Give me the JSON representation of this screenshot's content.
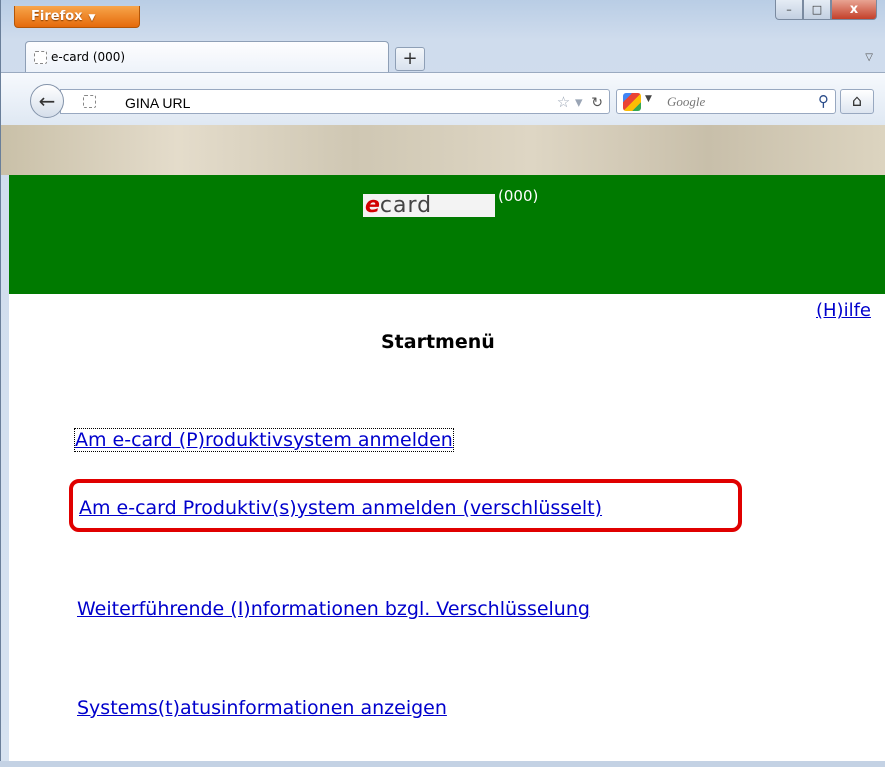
{
  "browser": {
    "app_button": "Firefox",
    "window_controls": {
      "minimize": "–",
      "maximize": "□",
      "close": "x"
    },
    "tab": {
      "title": "e-card (000)"
    },
    "new_tab_label": "+",
    "url": "GINA URL",
    "search": {
      "placeholder": "Google"
    }
  },
  "page": {
    "logo": {
      "e": "e",
      "card": "card"
    },
    "code": "(000)",
    "help_link": "(H)ilfe",
    "title": "Startmenü",
    "menu": [
      {
        "label": "Am e-card (P)roduktivsystem anmelden",
        "focused": true
      },
      {
        "label": "Am e-card Produktiv(s)ystem anmelden (verschlüsselt)",
        "highlighted": true
      },
      {
        "label": "Weiterführende (I)nformationen bzgl. Verschlüsselung"
      },
      {
        "label": "Systems(t)atusinformationen anzeigen"
      }
    ],
    "header_color": "#007a00",
    "highlight_color": "#e00000"
  }
}
